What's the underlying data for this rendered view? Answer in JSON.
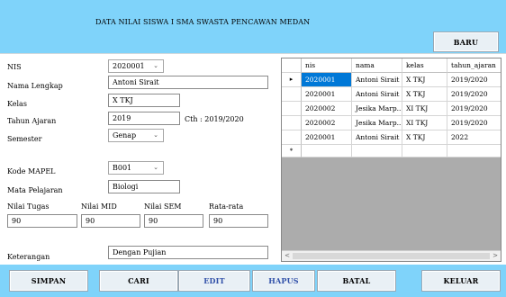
{
  "header": {
    "title": "DATA NILAI SISWA I SMA SWASTA PENCAWAN MEDAN"
  },
  "toolbar": {
    "baru": "BARU"
  },
  "form": {
    "nis_label": "NIS",
    "nis_value": "2020001",
    "nama_label": "Nama Lengkap",
    "nama_value": "Antoni Sirait",
    "kelas_label": "Kelas",
    "kelas_value": "X TKJ",
    "tahun_label": "Tahun Ajaran",
    "tahun_value": "2019",
    "tahun_hint": "Cth : 2019/2020",
    "semester_label": "Semester",
    "semester_value": "Genap",
    "kode_label": "Kode MAPEL",
    "kode_value": "B001",
    "mapel_label": "Mata Pelajaran",
    "mapel_value": "Biologi",
    "tugas_label": "Nilai Tugas",
    "tugas_value": "90",
    "mid_label": "Nilai MID",
    "mid_value": "90",
    "sem_label": "Nilai SEM",
    "sem_value": "90",
    "rata_label": "Rata-rata",
    "rata_value": "90",
    "ket_label": "Keterangan",
    "ket_value": "Dengan Pujian"
  },
  "grid": {
    "columns": [
      "nis",
      "nama",
      "kelas",
      "tahun_ajaran"
    ],
    "rows": [
      [
        "2020001",
        "Antoni Sirait",
        "X TKJ",
        "2019/2020"
      ],
      [
        "2020001",
        "Antoni Sirait",
        "X TKJ",
        "2019/2020"
      ],
      [
        "2020002",
        "Jesika Marp...",
        "XI TKJ",
        "2019/2020"
      ],
      [
        "2020002",
        "Jesika Marp...",
        "XI TKJ",
        "2019/2020"
      ],
      [
        "2020001",
        "Antoni Sirait",
        "X TKJ",
        "2022"
      ]
    ],
    "current_marker": "▸",
    "new_marker": "*"
  },
  "footer": {
    "simpan": "SIMPAN",
    "cari": "CARI",
    "edit": "EDIT",
    "hapus": "HAPUS",
    "batal": "BATAL",
    "keluar": "KELUAR"
  },
  "colors": {
    "header_bg": "#7fd3fa",
    "selection": "#0078d7",
    "button_text_blue": "#2f4fa8"
  }
}
